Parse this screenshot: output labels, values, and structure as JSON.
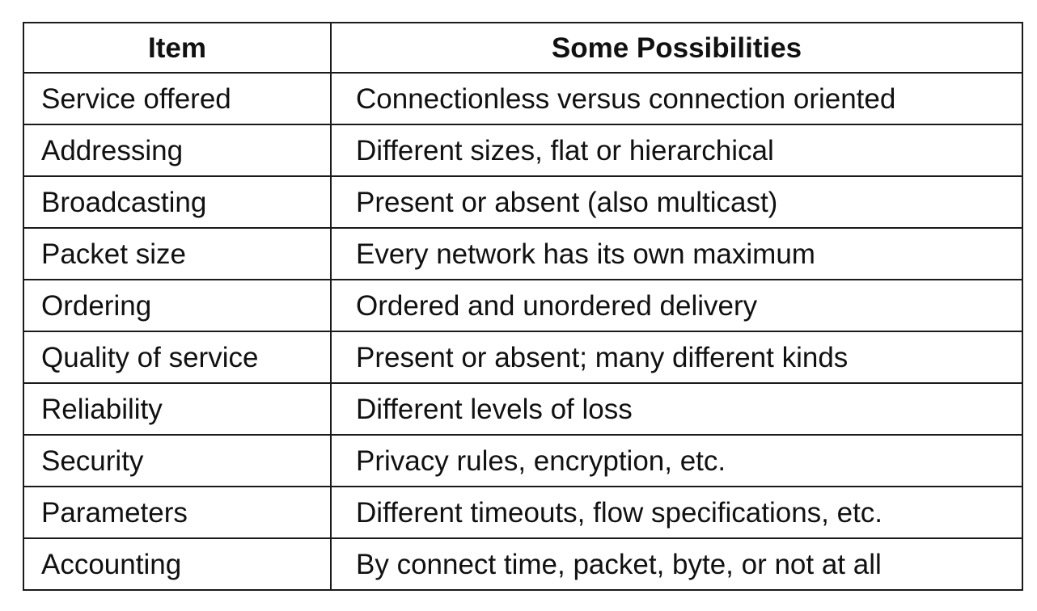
{
  "document": {
    "title_fragment": "",
    "title_color": "#ee1c1c",
    "table": {
      "headers": [
        "Item",
        "Some Possibilities"
      ],
      "rows": [
        {
          "item": "Service offered",
          "possibilities": "Connectionless versus connection oriented"
        },
        {
          "item": "Addressing",
          "possibilities": "Different sizes, flat or hierarchical"
        },
        {
          "item": "Broadcasting",
          "possibilities": "Present or absent (also multicast)"
        },
        {
          "item": "Packet size",
          "possibilities": "Every network has its own maximum"
        },
        {
          "item": "Ordering",
          "possibilities": "Ordered and unordered delivery"
        },
        {
          "item": "Quality of service",
          "possibilities": "Present or absent; many different kinds"
        },
        {
          "item": "Reliability",
          "possibilities": "Different levels of loss"
        },
        {
          "item": "Security",
          "possibilities": "Privacy rules, encryption, etc."
        },
        {
          "item": "Parameters",
          "possibilities": "Different timeouts, flow specifications, etc."
        },
        {
          "item": "Accounting",
          "possibilities": "By connect time, packet, byte, or not at all"
        }
      ]
    }
  }
}
